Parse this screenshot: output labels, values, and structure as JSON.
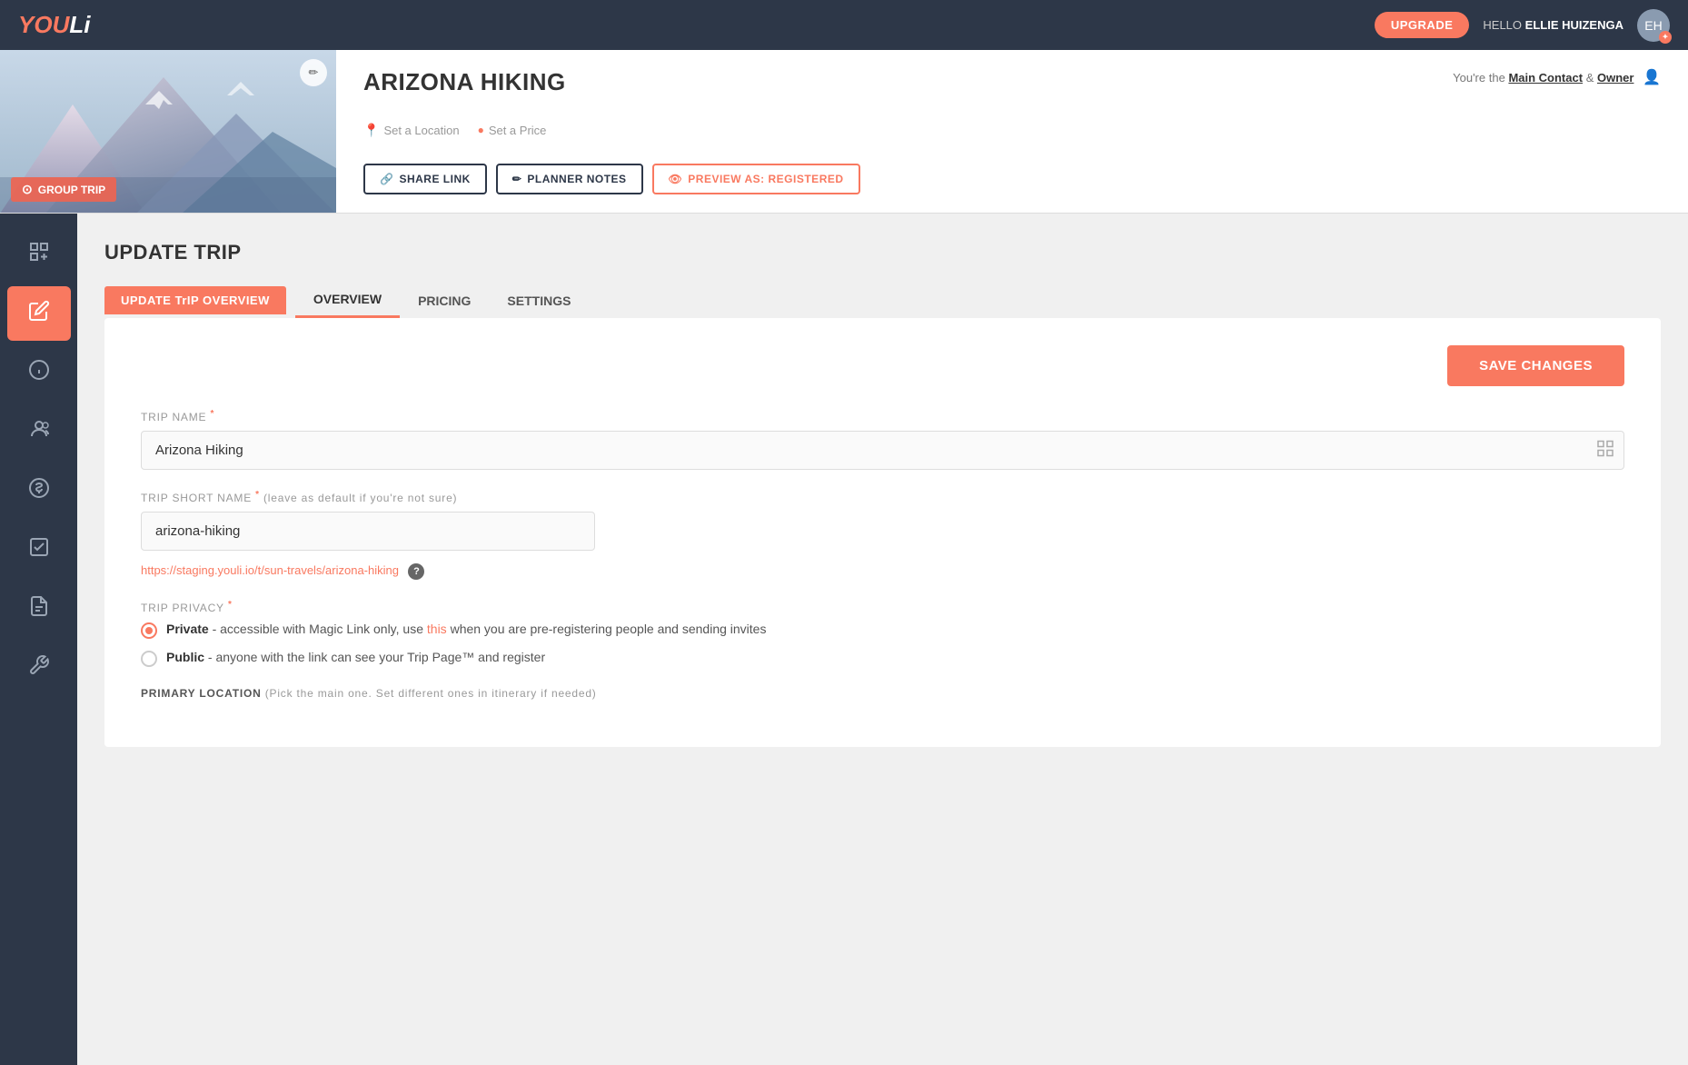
{
  "app": {
    "logo_text": "YOU",
    "logo_cursive": "Li"
  },
  "topnav": {
    "upgrade_label": "UPGRADE",
    "hello_prefix": "HELLO",
    "user_name": "ELLIE HUIZENGA",
    "avatar_initials": "EH"
  },
  "trip_header": {
    "title": "ARIZONA HIKING",
    "set_location": "Set a Location",
    "set_price": "Set a Price",
    "contact_text": "You're the",
    "main_contact": "Main Contact",
    "and_text": "&",
    "owner": "Owner",
    "group_trip_badge": "GROUP TRIP",
    "share_link": "SHARE LINK",
    "planner_notes": "PLANNER NOTES",
    "preview_as": "PREVIEW AS: REGISTERED"
  },
  "sidebar": {
    "items": [
      {
        "icon": "📊",
        "name": "dashboard"
      },
      {
        "icon": "✏️",
        "name": "edit",
        "active": true
      },
      {
        "icon": "ℹ️",
        "name": "info"
      },
      {
        "icon": "👤",
        "name": "contacts"
      },
      {
        "icon": "💲",
        "name": "pricing"
      },
      {
        "icon": "✓",
        "name": "checklist"
      },
      {
        "icon": "📄",
        "name": "notes"
      },
      {
        "icon": "🔧",
        "name": "settings"
      }
    ]
  },
  "content": {
    "page_title": "UPDATE TRIP",
    "update_trip_tab": "UPDATE TrIP OVERVIEW",
    "tabs": [
      {
        "label": "OVERVIEW",
        "active": true
      },
      {
        "label": "PRICING",
        "active": false
      },
      {
        "label": "SETTINGS",
        "active": false
      }
    ]
  },
  "form": {
    "save_changes": "SAVE CHANGES",
    "trip_name_label": "TRIP NAME",
    "trip_name_value": "Arizona Hiking",
    "trip_short_name_label": "TRIP SHORT NAME",
    "trip_short_name_note": "(leave as default if you're not sure)",
    "trip_short_name_value": "arizona-hiking",
    "trip_url": "https://staging.youli.io/t/sun-travels/arizona-hiking",
    "trip_privacy_label": "TRIP PRIVACY",
    "privacy_private_label": "Private",
    "privacy_private_desc": "- accessible with Magic Link only, use",
    "privacy_private_link": "this",
    "privacy_private_desc2": "when you are pre-registering people and sending invites",
    "privacy_public_label": "Public",
    "privacy_public_desc": "- anyone with the link can see your Trip Page™ and register",
    "primary_location_label": "PRIMARY LOCATION",
    "primary_location_note": "(Pick the main one. Set different ones in itinerary if needed)"
  }
}
